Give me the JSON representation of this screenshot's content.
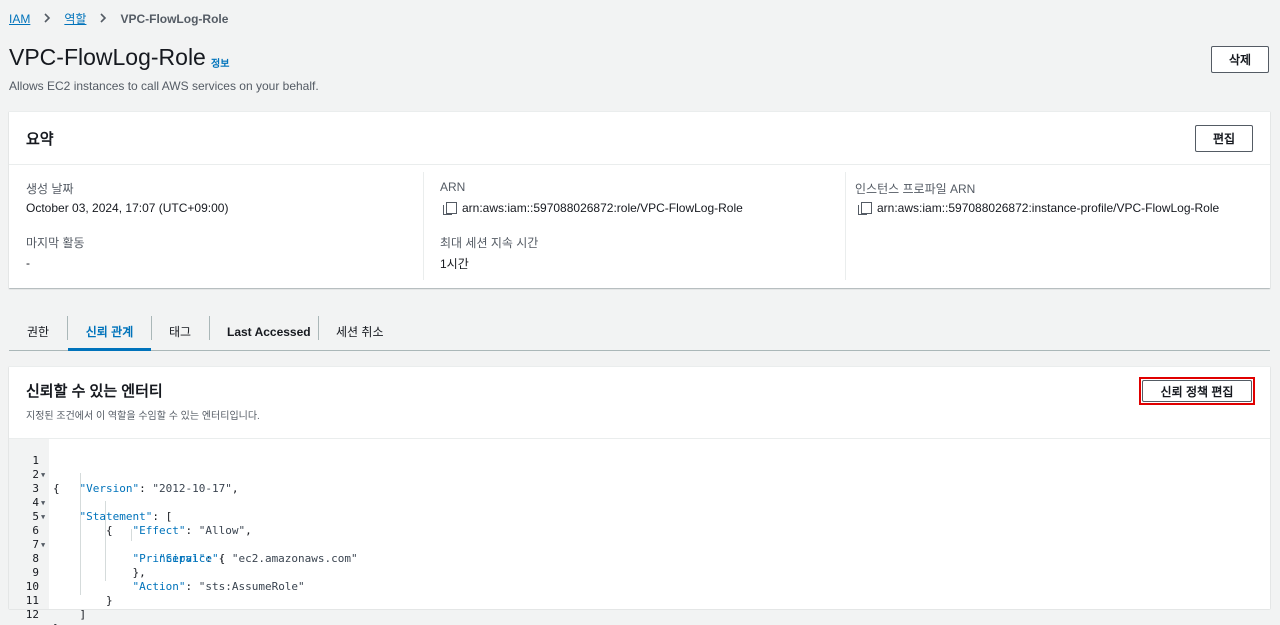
{
  "breadcrumb": {
    "items": [
      "IAM",
      "역할"
    ],
    "current": "VPC-FlowLog-Role"
  },
  "header": {
    "title": "VPC-FlowLog-Role",
    "info_link": "정보",
    "description": "Allows EC2 instances to call AWS services on your behalf.",
    "delete_label": "삭제"
  },
  "summary": {
    "title": "요약",
    "edit_label": "편집",
    "created_label": "생성 날짜",
    "created_value": "October 03, 2024, 17:07 (UTC+09:00)",
    "last_activity_label": "마지막 활동",
    "last_activity_value": "-",
    "arn_label": "ARN",
    "arn_value": "arn:aws:iam::597088026872:role/VPC-FlowLog-Role",
    "max_session_label": "최대 세션 지속 시간",
    "max_session_value": "1시간",
    "instance_profile_label": "인스턴스 프로파일 ARN",
    "instance_profile_value": "arn:aws:iam::597088026872:instance-profile/VPC-FlowLog-Role"
  },
  "tabs": [
    "권한",
    "신뢰 관계",
    "태그",
    "Last Accessed",
    "세션 취소"
  ],
  "active_tab": "신뢰 관계",
  "trust": {
    "title": "신뢰할 수 있는 엔터티",
    "description": "지정된 조건에서 이 역할을 수임할 수 있는 엔터티입니다.",
    "edit_button": "신뢰 정책 편집"
  },
  "code_lines": [
    "{",
    "    \"Version\": \"2012-10-17\",",
    "    \"Statement\": [",
    "        {",
    "            \"Effect\": \"Allow\",",
    "            \"Principal\": {",
    "                \"Service\": \"ec2.amazonaws.com\"",
    "            },",
    "            \"Action\": \"sts:AssumeRole\"",
    "        }",
    "    ]",
    "}"
  ],
  "line_numbers": [
    "1",
    "2",
    "3",
    "4",
    "5",
    "6",
    "7",
    "8",
    "9",
    "10",
    "11",
    "12"
  ],
  "colors": {
    "link": "#0073bb",
    "highlight_border": "#e00000",
    "background": "#f2f3f3"
  }
}
